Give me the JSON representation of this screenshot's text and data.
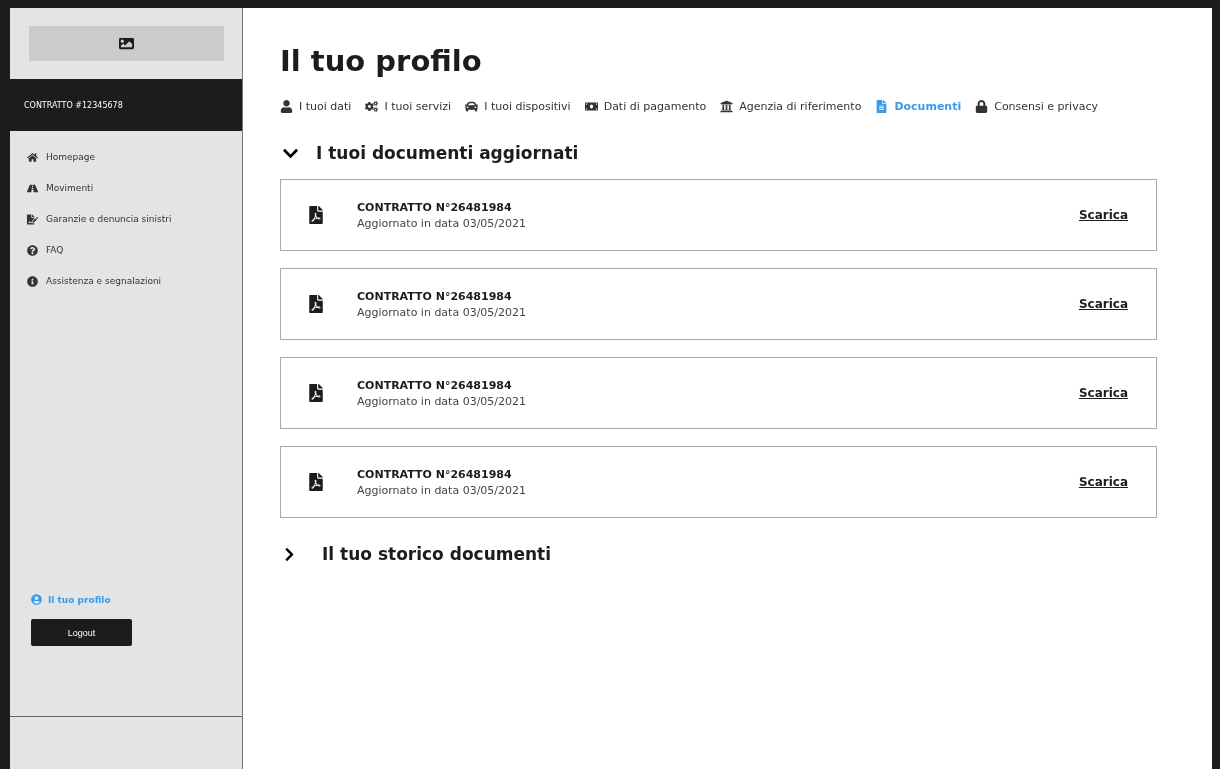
{
  "sidebar": {
    "contract": "CONTRATTO #12345678",
    "items": [
      {
        "label": "Homepage"
      },
      {
        "label": "Movimenti"
      },
      {
        "label": "Garanzie e denuncia sinistri"
      },
      {
        "label": "FAQ"
      },
      {
        "label": "Assistenza e segnalazioni"
      }
    ],
    "profile_link": {
      "label": "Il tuo profilo",
      "selected": true
    },
    "logout": "Logout"
  },
  "title": "Il tuo profilo",
  "tabs": [
    {
      "label": "I tuoi dati",
      "selected": false
    },
    {
      "label": "I tuoi servizi",
      "selected": false
    },
    {
      "label": "I tuoi dispositivi",
      "selected": false
    },
    {
      "label": "Dati di pagamento",
      "selected": false
    },
    {
      "label": "Agenzia di riferimento",
      "selected": false
    },
    {
      "label": "Documenti",
      "selected": true
    },
    {
      "label": "Consensi e privacy",
      "selected": false
    }
  ],
  "sections": [
    {
      "title": "I tuoi documenti aggiornati",
      "expanded": true,
      "documents": [
        {
          "name": "CONTRATTO N°26481984",
          "date": "Aggiornato in data 03/05/2021",
          "action": "Scarica"
        },
        {
          "name": "CONTRATTO N°26481984",
          "date": "Aggiornato in data 03/05/2021",
          "action": "Scarica"
        },
        {
          "name": "CONTRATTO N°26481984",
          "date": "Aggiornato in data 03/05/2021",
          "action": "Scarica"
        },
        {
          "name": "CONTRATTO N°26481984",
          "date": "Aggiornato in data 03/05/2021",
          "action": "Scarica"
        }
      ]
    },
    {
      "title": "Il tuo storico documenti",
      "expanded": false
    }
  ]
}
